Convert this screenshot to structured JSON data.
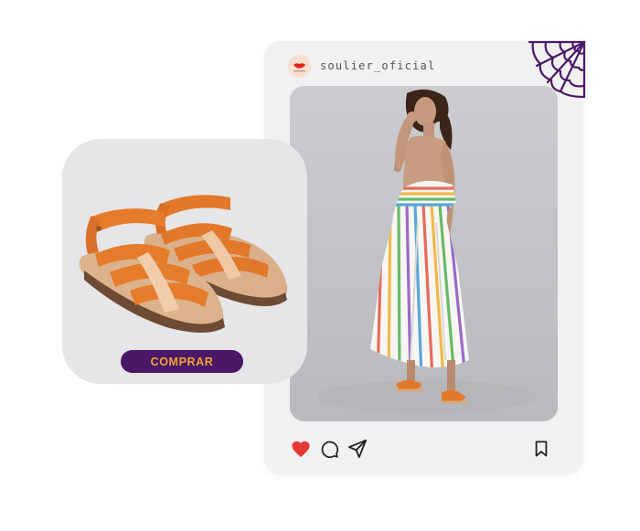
{
  "post": {
    "username": "soulier_oficial",
    "avatar": "brand-logo-avatar",
    "photo": "model-in-striped-dress-photo",
    "actions": {
      "like_icon": "heart-filled-icon",
      "comment_icon": "comment-bubble-icon",
      "share_icon": "send-arrow-icon",
      "save_icon": "bookmark-icon"
    },
    "decoration": "spider-web-icon"
  },
  "product": {
    "image": "orange-sandals-photo",
    "button_label": "COMPRAR"
  },
  "colors": {
    "brand_purple": "#4b1767",
    "button_text": "#f2a43a",
    "like_red": "#e53935",
    "card_background": "#f1f1f1",
    "product_background": "#e6e6e8"
  }
}
